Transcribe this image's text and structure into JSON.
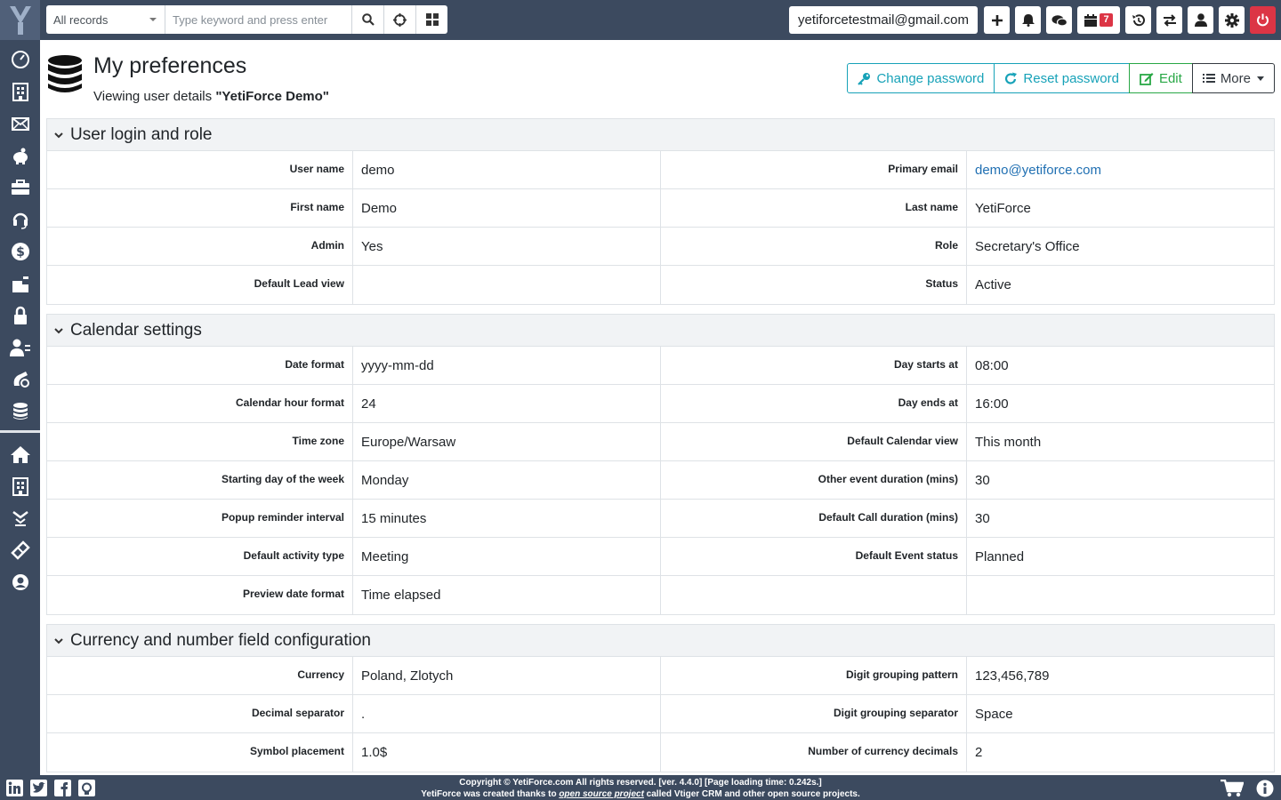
{
  "search": {
    "scope": "All records",
    "placeholder": "Type keyword and press enter"
  },
  "topbar": {
    "user_email": "yetiforcetestmail@gmail.com",
    "calendar_badge": "7"
  },
  "header": {
    "title": "My preferences",
    "subtitle_prefix": "Viewing user details ",
    "subtitle_name": "\"YetiForce Demo\""
  },
  "actions": {
    "change_password": "Change password",
    "reset_password": "Reset password",
    "edit": "Edit",
    "more": "More"
  },
  "blocks": [
    {
      "title": "User login and role",
      "rows": [
        [
          {
            "label": "User name",
            "value": "demo"
          },
          {
            "label": "Primary email",
            "value": "demo@yetiforce.com"
          }
        ],
        [
          {
            "label": "First name",
            "value": "Demo"
          },
          {
            "label": "Last name",
            "value": "YetiForce"
          }
        ],
        [
          {
            "label": "Admin",
            "value": "Yes"
          },
          {
            "label": "Role",
            "value": "Secretary's Office"
          }
        ],
        [
          {
            "label": "Default Lead view",
            "value": ""
          },
          {
            "label": "Status",
            "value": "Active"
          }
        ]
      ]
    },
    {
      "title": "Calendar settings",
      "rows": [
        [
          {
            "label": "Date format",
            "value": "yyyy-mm-dd"
          },
          {
            "label": "Day starts at",
            "value": "08:00"
          }
        ],
        [
          {
            "label": "Calendar hour format",
            "value": "24"
          },
          {
            "label": "Day ends at",
            "value": "16:00"
          }
        ],
        [
          {
            "label": "Time zone",
            "value": "Europe/Warsaw"
          },
          {
            "label": "Default Calendar view",
            "value": "This month"
          }
        ],
        [
          {
            "label": "Starting day of the week",
            "value": "Monday"
          },
          {
            "label": "Other event duration (mins)",
            "value": "30"
          }
        ],
        [
          {
            "label": "Popup reminder interval",
            "value": "15 minutes"
          },
          {
            "label": "Default Call duration (mins)",
            "value": "30"
          }
        ],
        [
          {
            "label": "Default activity type",
            "value": "Meeting"
          },
          {
            "label": "Default Event status",
            "value": "Planned"
          }
        ],
        [
          {
            "label": "Preview date format",
            "value": "Time elapsed"
          },
          {
            "label": "",
            "value": ""
          }
        ]
      ]
    },
    {
      "title": "Currency and number field configuration",
      "rows": [
        [
          {
            "label": "Currency",
            "value": "Poland, Zlotych"
          },
          {
            "label": "Digit grouping pattern",
            "value": "123,456,789"
          }
        ],
        [
          {
            "label": "Decimal separator",
            "value": "."
          },
          {
            "label": "Digit grouping separator",
            "value": "Space"
          }
        ],
        [
          {
            "label": "Symbol placement",
            "value": "1.0$"
          },
          {
            "label": "Number of currency decimals",
            "value": "2"
          }
        ]
      ]
    }
  ],
  "footer": {
    "copyright": "Copyright © YetiForce.com All rights reserved. [ver. 4.4.0] [Page loading time: 0.242s.]",
    "credits_pre": "YetiForce was created thanks to ",
    "credits_link": "open source project",
    "credits_post": " called Vtiger CRM and other open source projects."
  },
  "colors": {
    "sidebar_bg": "#3c4a5f",
    "info": "#17a2b8",
    "success": "#28a745",
    "danger": "#dc3545",
    "link": "#1f6fb2"
  },
  "icons": {
    "sidebar": [
      "dashboard-icon",
      "accounts-icon",
      "marketing-icon",
      "sales-icon",
      "projects-icon",
      "support-icon",
      "finances-icon",
      "inventory-icon",
      "security-icon",
      "hr-icon",
      "tools-icon",
      "database-icon",
      "home-icon",
      "company-icon",
      "collapse-icon",
      "ticket-icon",
      "user-icon"
    ],
    "footer_social": [
      "linkedin-icon",
      "twitter-icon",
      "facebook-icon",
      "github-icon"
    ]
  }
}
